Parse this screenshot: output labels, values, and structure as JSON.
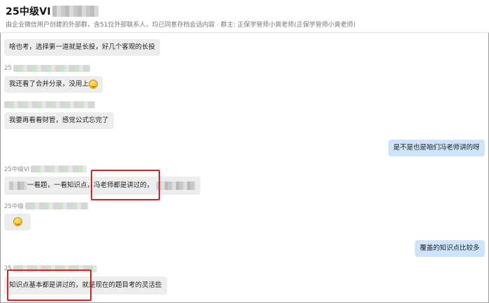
{
  "header": {
    "title": "25中级VI",
    "subtitle": "由企业微信用户创建的外部群，含51位外部联系人，均已同意存档会话内容 · 群主: 正保学管师小爽老师(正保学管师小爽老师)"
  },
  "messages": [
    {
      "text": "啥也考，选择第一道就是长投，好几个客观的长投"
    },
    {
      "sender": "25",
      "text": "我还看了合并分录，没用上",
      "emoji": "sweat-smile-emoji"
    },
    {
      "text": "我要再看看财管，感觉公式忘完了"
    },
    {
      "self": true,
      "text": "是不是也是咱们冯老师讲的呀"
    },
    {
      "sender": "25中级VI",
      "text_a": "一看题，一看知识点，",
      "text_b": "冯老师都是讲过的，"
    },
    {
      "sender": "25中级",
      "emoji": "face-emoji"
    },
    {
      "self": true,
      "text": "覆盖的知识点比较多"
    },
    {
      "sender": "25",
      "text_a": "知识点基本都是讲过的，",
      "text_b": "就是现在的题目考的灵活些"
    }
  ],
  "colors": {
    "highlight_box": "#e02020",
    "self_bubble": "#cde4fb",
    "other_bubble": "#ededed"
  }
}
